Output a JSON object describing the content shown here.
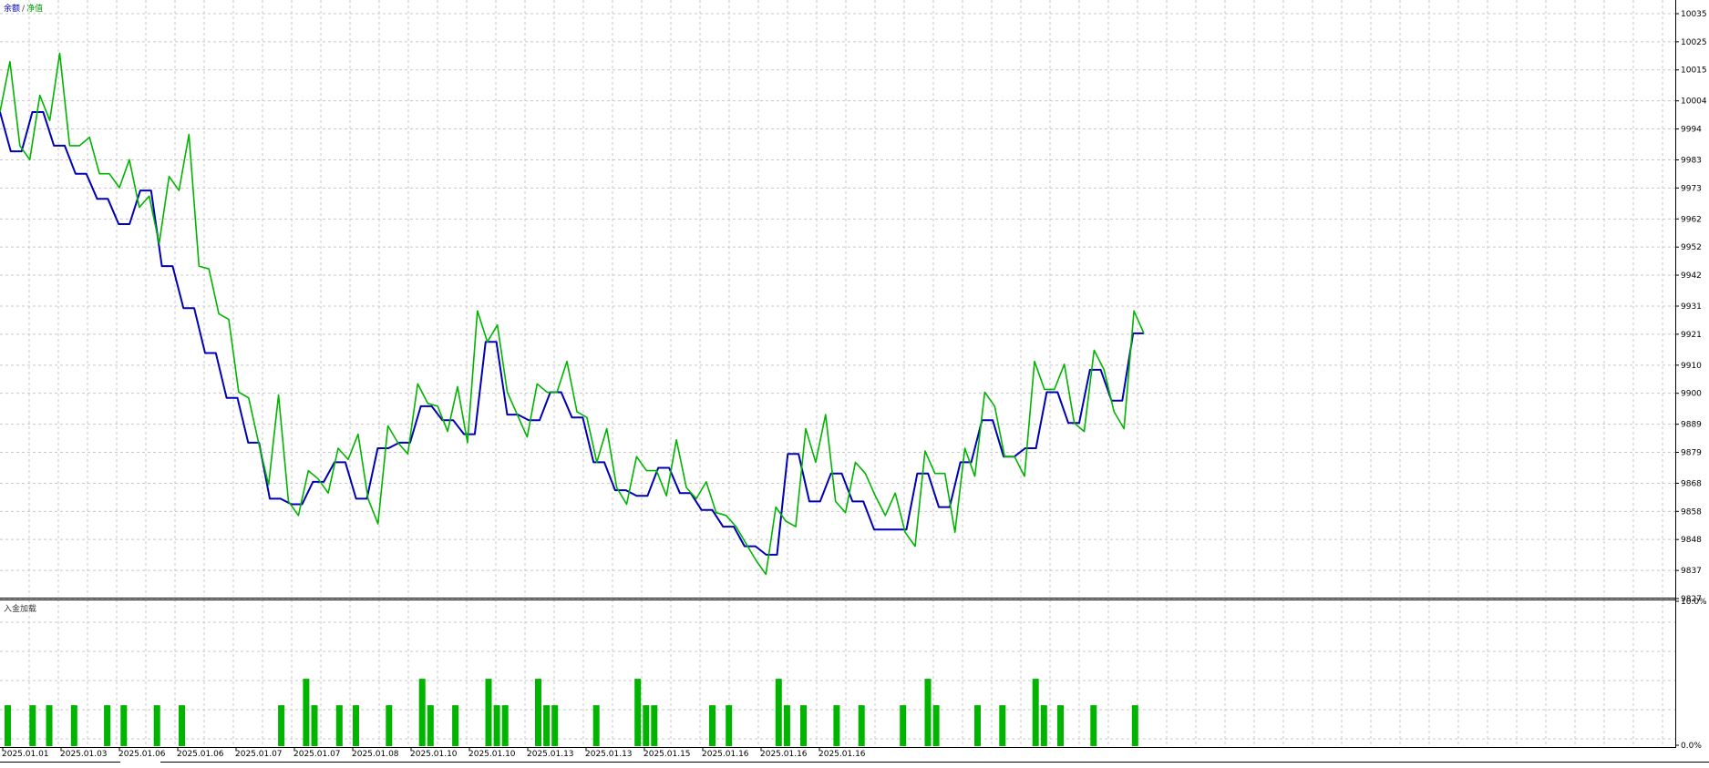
{
  "chart_data": [
    {
      "type": "line",
      "legend_labels": {
        "balance": "余额",
        "separator": "/",
        "equity": "净值"
      },
      "y_ticks": [
        9827,
        9837,
        9848,
        9858,
        9868,
        9879,
        9889,
        9900,
        9910,
        9921,
        9931,
        9942,
        9952,
        9962,
        9973,
        9983,
        9994,
        10004,
        10015,
        10025,
        10035
      ],
      "ylim": [
        9827,
        10040
      ],
      "x_tick_labels": [
        "2025.01.01",
        "2025.01.03",
        "2025.01.06",
        "2025.01.06",
        "2025.01.07",
        "2025.01.07",
        "2025.01.08",
        "2025.01.10",
        "2025.01.10",
        "2025.01.13",
        "2025.01.13",
        "2025.01.15",
        "2025.01.16",
        "2025.01.16",
        "2025.01.16"
      ],
      "grid": true,
      "series": [
        {
          "name": "余额",
          "color": "#0000b4",
          "values": [
            10000,
            9986,
            9986,
            10000,
            10000,
            9988,
            9988,
            9978,
            9978,
            9969,
            9969,
            9960,
            9960,
            9972,
            9972,
            9945,
            9945,
            9930,
            9930,
            9914,
            9914,
            9898,
            9898,
            9882,
            9882,
            9862,
            9862,
            9860,
            9860,
            9868,
            9868,
            9875,
            9875,
            9862,
            9862,
            9880,
            9880,
            9882,
            9882,
            9895,
            9895,
            9890,
            9890,
            9885,
            9885,
            9918,
            9918,
            9892,
            9892,
            9890,
            9890,
            9900,
            9900,
            9891,
            9891,
            9875,
            9875,
            9865,
            9865,
            9863,
            9863,
            9873,
            9873,
            9864,
            9864,
            9858,
            9858,
            9852,
            9852,
            9845,
            9845,
            9842,
            9842,
            9878,
            9878,
            9861,
            9861,
            9871,
            9871,
            9861,
            9861,
            9851,
            9851,
            9851,
            9851,
            9871,
            9871,
            9859,
            9859,
            9875,
            9875,
            9890,
            9890,
            9877,
            9877,
            9880,
            9880,
            9900,
            9900,
            9889,
            9889,
            9908,
            9908,
            9897,
            9897,
            9921,
            9921
          ]
        },
        {
          "name": "净值",
          "color": "#00b400",
          "values": [
            10000,
            10018,
            9988,
            9983,
            10006,
            9997,
            10021,
            9988,
            9988,
            9991,
            9978,
            9978,
            9973,
            9983,
            9966,
            9970,
            9953,
            9977,
            9972,
            9992,
            9945,
            9944,
            9928,
            9926,
            9900,
            9898,
            9882,
            9867,
            9899,
            9861,
            9856,
            9872,
            9869,
            9864,
            9880,
            9876,
            9885,
            9862,
            9853,
            9888,
            9882,
            9878,
            9903,
            9896,
            9895,
            9886,
            9902,
            9882,
            9929,
            9918,
            9924,
            9900,
            9892,
            9884,
            9903,
            9900,
            9900,
            9911,
            9893,
            9891,
            9875,
            9887,
            9866,
            9860,
            9877,
            9872,
            9872,
            9863,
            9883,
            9866,
            9862,
            9868,
            9857,
            9856,
            9852,
            9846,
            9840,
            9835,
            9859,
            9854,
            9852,
            9887,
            9875,
            9892,
            9861,
            9857,
            9875,
            9871,
            9863,
            9856,
            9864,
            9850,
            9845,
            9879,
            9871,
            9871,
            9850,
            9880,
            9870,
            9900,
            9895,
            9877,
            9877,
            9870,
            9911,
            9901,
            9901,
            9910,
            9889,
            9886,
            9915,
            9908,
            9893,
            9887,
            9929,
            9921
          ]
        }
      ]
    },
    {
      "type": "bar",
      "title": "入金加载",
      "y_ticks": [
        "10.0%",
        "0.0%"
      ],
      "ylim": [
        0,
        10
      ],
      "grid": true,
      "color": "#00b400",
      "values": [
        1.7,
        0,
        0,
        1.7,
        0,
        1.7,
        0,
        0,
        1.7,
        0,
        0,
        0,
        1.7,
        0,
        1.7,
        0,
        0,
        0,
        1.7,
        0,
        0,
        1.7,
        0,
        0,
        0,
        0,
        0,
        0,
        0,
        0,
        0,
        0,
        0,
        1.7,
        0,
        0,
        2.8,
        1.7,
        0,
        0,
        1.7,
        0,
        1.7,
        0,
        0,
        0,
        1.7,
        0,
        0,
        0,
        2.8,
        1.7,
        0,
        0,
        1.7,
        0,
        0,
        0,
        2.8,
        1.7,
        1.7,
        0,
        0,
        0,
        2.8,
        1.7,
        1.7,
        0,
        0,
        0,
        0,
        1.7,
        0,
        0,
        0,
        0,
        2.8,
        1.7,
        1.7,
        0,
        0,
        0,
        0,
        0,
        0,
        1.7,
        0,
        1.7,
        0,
        0,
        0,
        0,
        0,
        2.8,
        1.7,
        0,
        1.7,
        0,
        0,
        0,
        1.7,
        0,
        0,
        1.7,
        0,
        0,
        0,
        0,
        1.7,
        0,
        0,
        2.8,
        1.7,
        0,
        0,
        0,
        0,
        1.7,
        0,
        0,
        1.7,
        0,
        0,
        0,
        2.8,
        1.7,
        0,
        1.7,
        0,
        0,
        0,
        1.7,
        0,
        0,
        0,
        0,
        1.7,
        0,
        0
      ]
    }
  ]
}
